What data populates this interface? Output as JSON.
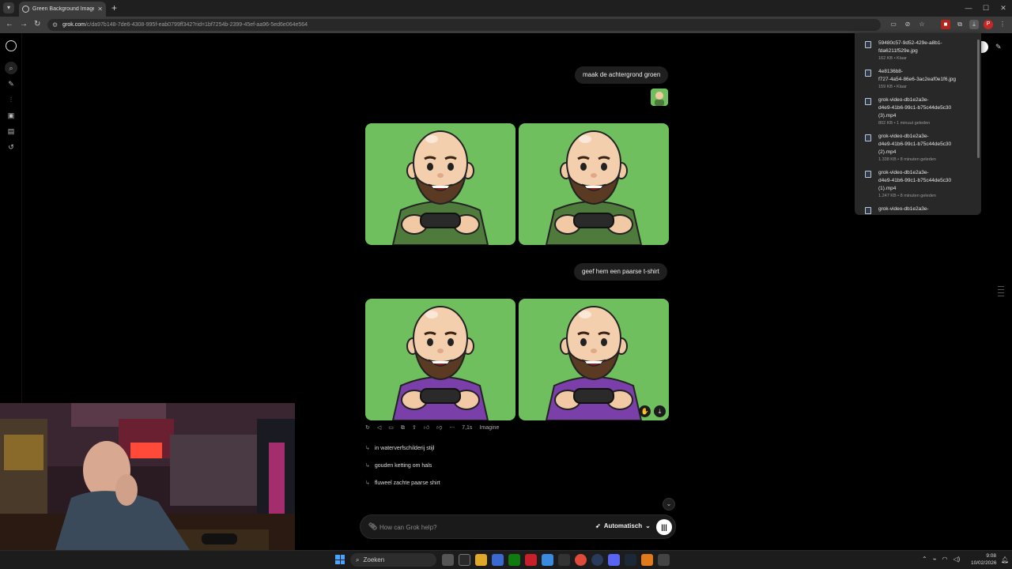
{
  "browser": {
    "tab_title": "Green Background Image Edit",
    "url_host": "grok.com",
    "url_path": "/c/da97b148-7de6-4308-995f-eab0799ff342?rid=1bf7254b-2399-45ef-aa96-5ed6e064e564",
    "profile_initial": "P"
  },
  "chat": {
    "message_1": "maak de achtergrond groen",
    "message_2": "geef hem een paarse t-shirt",
    "response_time": "7,1s",
    "response_mode": "Imagine",
    "suggestions": [
      "in waterverfschilderij stijl",
      "gouden ketting om hals",
      "fluweel zachte paarse shirt"
    ]
  },
  "composer": {
    "placeholder": "How can Grok help?",
    "mode_label": "Automatisch"
  },
  "downloads": [
    {
      "name_l1": "59480c57-9d52-429e-a8b1-",
      "name_l2": "fda6211f529e.jpg",
      "name_l3": "",
      "meta": "162 KB • Klaar"
    },
    {
      "name_l1": "4e8136b8-",
      "name_l2": "f727-4a54-86e6-3ac2eaf0e1f6.jpg",
      "name_l3": "",
      "meta": "159 KB • Klaar"
    },
    {
      "name_l1": "grok-video-db1e2a3e-",
      "name_l2": "d4e9-41b6-99c1-b75c44de5c30",
      "name_l3": "(3).mp4",
      "meta": "802 KB • 1 minuut geleden"
    },
    {
      "name_l1": "grok-video-db1e2a3e-",
      "name_l2": "d4e9-41b6-99c1-b75c44de5c30",
      "name_l3": "(2).mp4",
      "meta": "1.338 KB • 8 minuten geleden"
    },
    {
      "name_l1": "grok-video-db1e2a3e-",
      "name_l2": "d4e9-41b6-99c1-b75c44de5c30",
      "name_l3": "(1).mp4",
      "meta": "1.247 KB • 8 minuten geleden"
    },
    {
      "name_l1": "grok-video-db1e2a3e-",
      "name_l2": "",
      "name_l3": "",
      "meta": ""
    }
  ],
  "taskbar": {
    "search_label": "Zoeken",
    "time": "9:08",
    "date": "10/02/2026"
  },
  "colors": {
    "image_bg": "#6fbf5e",
    "shirt_green": "#4e7a3c",
    "shirt_purple": "#7a3fa8"
  }
}
